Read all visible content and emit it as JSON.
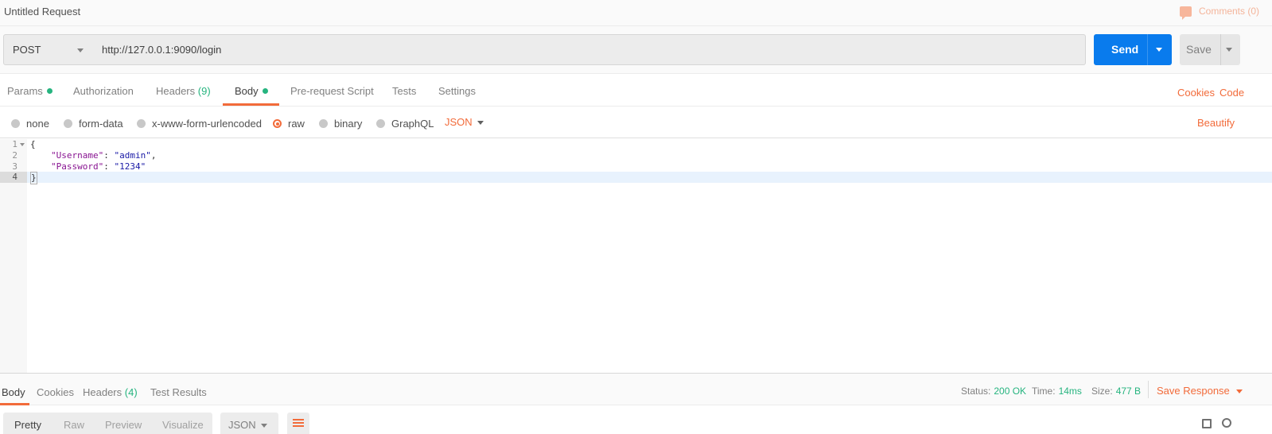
{
  "header": {
    "title": "Untitled Request",
    "comments_label": "Comments (0)"
  },
  "request": {
    "method": "POST",
    "url": "http://127.0.0.1:9090/login",
    "send_label": "Send",
    "save_label": "Save"
  },
  "tabs": [
    {
      "label": "Params",
      "dot": true
    },
    {
      "label": "Authorization"
    },
    {
      "label": "Headers",
      "count": "(9)"
    },
    {
      "label": "Body",
      "dot": true,
      "active": true
    },
    {
      "label": "Pre-request Script"
    },
    {
      "label": "Tests"
    },
    {
      "label": "Settings"
    }
  ],
  "tab_links": {
    "cookies": "Cookies",
    "code": "Code"
  },
  "body_types": [
    {
      "label": "none"
    },
    {
      "label": "form-data"
    },
    {
      "label": "x-www-form-urlencoded"
    },
    {
      "label": "raw",
      "selected": true
    },
    {
      "label": "binary"
    },
    {
      "label": "GraphQL"
    }
  ],
  "raw_language": "JSON",
  "beautify_label": "Beautify",
  "editor": {
    "line_numbers": [
      "1",
      "2",
      "3",
      "4"
    ],
    "lines": [
      {
        "text": "{"
      },
      {
        "key": "\"Username\"",
        "value": "\"admin\"",
        "suffix": ","
      },
      {
        "key": "\"Password\"",
        "value": "\"1234\""
      },
      {
        "text": "}"
      }
    ]
  },
  "response": {
    "tabs": [
      {
        "label": "Body",
        "active": true
      },
      {
        "label": "Cookies"
      },
      {
        "label": "Headers",
        "count": "(4)"
      },
      {
        "label": "Test Results"
      }
    ],
    "status_label": "Status:",
    "status_value": "200 OK",
    "time_label": "Time:",
    "time_value": "14ms",
    "size_label": "Size:",
    "size_value": "477 B",
    "save_response_label": "Save Response",
    "view_modes": [
      "Pretty",
      "Raw",
      "Preview",
      "Visualize"
    ],
    "format": "JSON"
  },
  "colors": {
    "accent": "#f26b3a",
    "primary": "#097bed",
    "success": "#26b47f"
  }
}
